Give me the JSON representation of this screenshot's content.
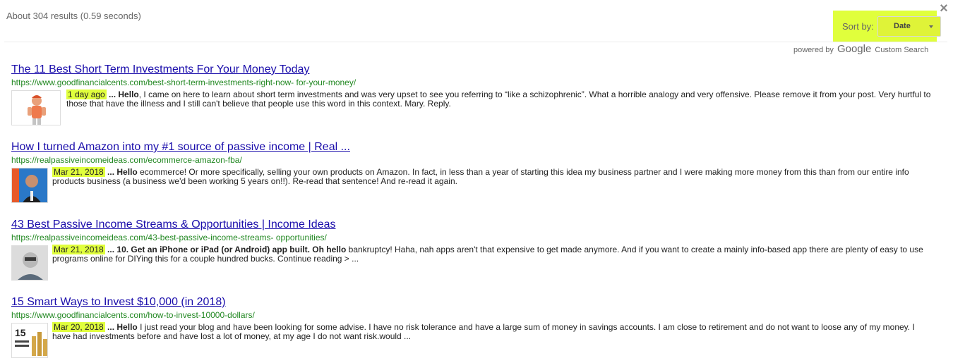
{
  "header": {
    "result_info": "About 304 results (0.59 seconds)",
    "sort_label": "Sort by:",
    "sort_value": "Date",
    "powered_prefix": "powered by",
    "powered_brand": "Google",
    "powered_suffix": "Custom Search",
    "highlight_color": "#e0ff3c"
  },
  "results": [
    {
      "title": "The 11 Best Short Term Investments For Your Money Today",
      "url": "https://www.goodfinancialcents.com/best-short-term-investments-right-now- for-your-money/",
      "date": "1 day ago",
      "sep": " ... ",
      "keyword": "Hello",
      "text": ", I came on here to learn about short term investments and was very upset to see you referring to “like a schizophrenic”. What a horrible analogy and very offensive. Please remove it from your post. Very hurtful to those that have the illness and I still can't believe that people use this word in this context. Mary. Reply."
    },
    {
      "title": "How I turned Amazon into my #1 source of passive income | Real ...",
      "url": "https://realpassiveincomeideas.com/ecommerce-amazon-fba/",
      "date": "Mar 21, 2018",
      "sep": " ... ",
      "keyword": "Hello",
      "text": " ecommerce! Or more specifically, selling your own products on Amazon. In fact, in less than a year of starting this idea my business partner and I were making more money from this than from our entire info products business (a business we'd been working 5 years on!!). Re-read that sentence! And re-read it again."
    },
    {
      "title": "43 Best Passive Income Streams & Opportunities | Income Ideas",
      "url": "https://realpassiveincomeideas.com/43-best-passive-income-streams- opportunities/",
      "date": "Mar 21, 2018",
      "sep": " ... 10. Get an iPhone or iPad (or Android) app built. Oh ",
      "keyword": "hello",
      "text": " bankruptcy! Haha, nah apps aren't that expensive to get made anymore. And if you want to create a mainly info-based app there are plenty of easy to use programs online for DIYing this for a couple hundred bucks. Continue reading > ..."
    },
    {
      "title": "15 Smart Ways to Invest $10,000 (in 2018)",
      "url": "https://www.goodfinancialcents.com/how-to-invest-10000-dollars/",
      "date": "Mar 20, 2018",
      "sep": " ... ",
      "keyword": "Hello",
      "text": " I just read your blog and have been looking for some advise. I have no risk tolerance and have a large sum of money in savings accounts. I am close to retirement and do not want to loose any of my money. I have had investments before and have lost a lot of money, at my age I do not want risk.would ...",
      "thumb_text": "15"
    }
  ]
}
